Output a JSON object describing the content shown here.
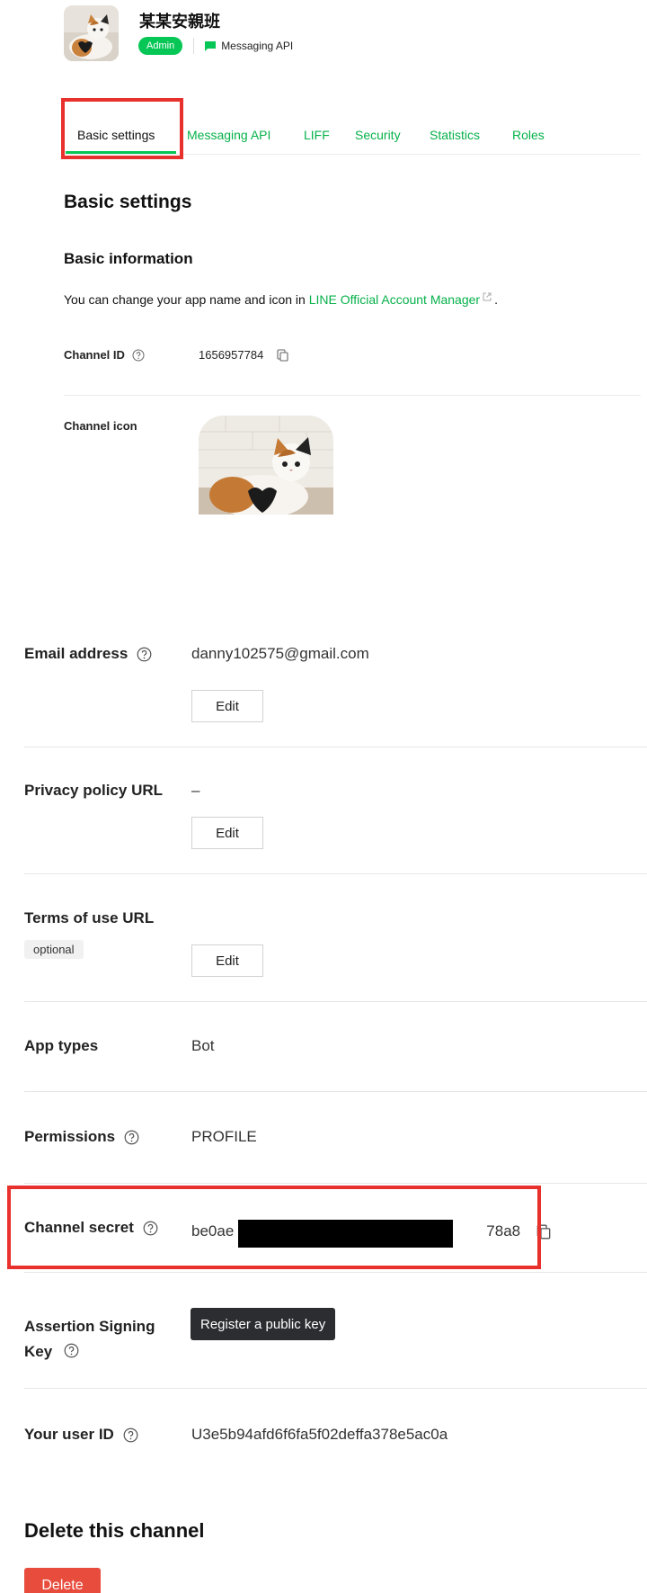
{
  "channel": {
    "name": "某某安親班",
    "role_badge": "Admin",
    "type_label": "Messaging API"
  },
  "tabs": [
    {
      "label": "Basic settings",
      "active": true
    },
    {
      "label": "Messaging API"
    },
    {
      "label": "LIFF"
    },
    {
      "label": "Security"
    },
    {
      "label": "Statistics"
    },
    {
      "label": "Roles"
    }
  ],
  "page_title": "Basic settings",
  "basic_info": {
    "heading": "Basic information",
    "intro_prefix": "You can change your app name and icon in ",
    "intro_link": "LINE Official Account Manager",
    "intro_suffix": ".",
    "channel_id_label": "Channel ID",
    "channel_id_value": "1656957784",
    "channel_icon_label": "Channel icon"
  },
  "fields": {
    "email_label": "Email address",
    "email_value": "danny102575@gmail.com",
    "privacy_label": "Privacy policy URL",
    "privacy_value": "–",
    "terms_label": "Terms of use URL",
    "terms_optional": "optional",
    "app_types_label": "App types",
    "app_types_value": "Bot",
    "permissions_label": "Permissions",
    "permissions_value": "PROFILE",
    "secret_label": "Channel secret",
    "secret_prefix": "be0ae",
    "secret_suffix": "78a8",
    "assertion_label": "Assertion Signing Key",
    "assertion_button": "Register a public key",
    "user_id_label": "Your user ID",
    "user_id_value": "U3e5b94afd6f6fa5f02deffa378e5ac0a"
  },
  "edit_label": "Edit",
  "delete": {
    "title": "Delete this channel",
    "button": "Delete"
  },
  "colors": {
    "brand_green": "#06c755",
    "link_green": "#06b14a",
    "annotation_red": "#e8312c",
    "delete_red": "#e84c3d",
    "dark_button": "#2b2d31"
  }
}
